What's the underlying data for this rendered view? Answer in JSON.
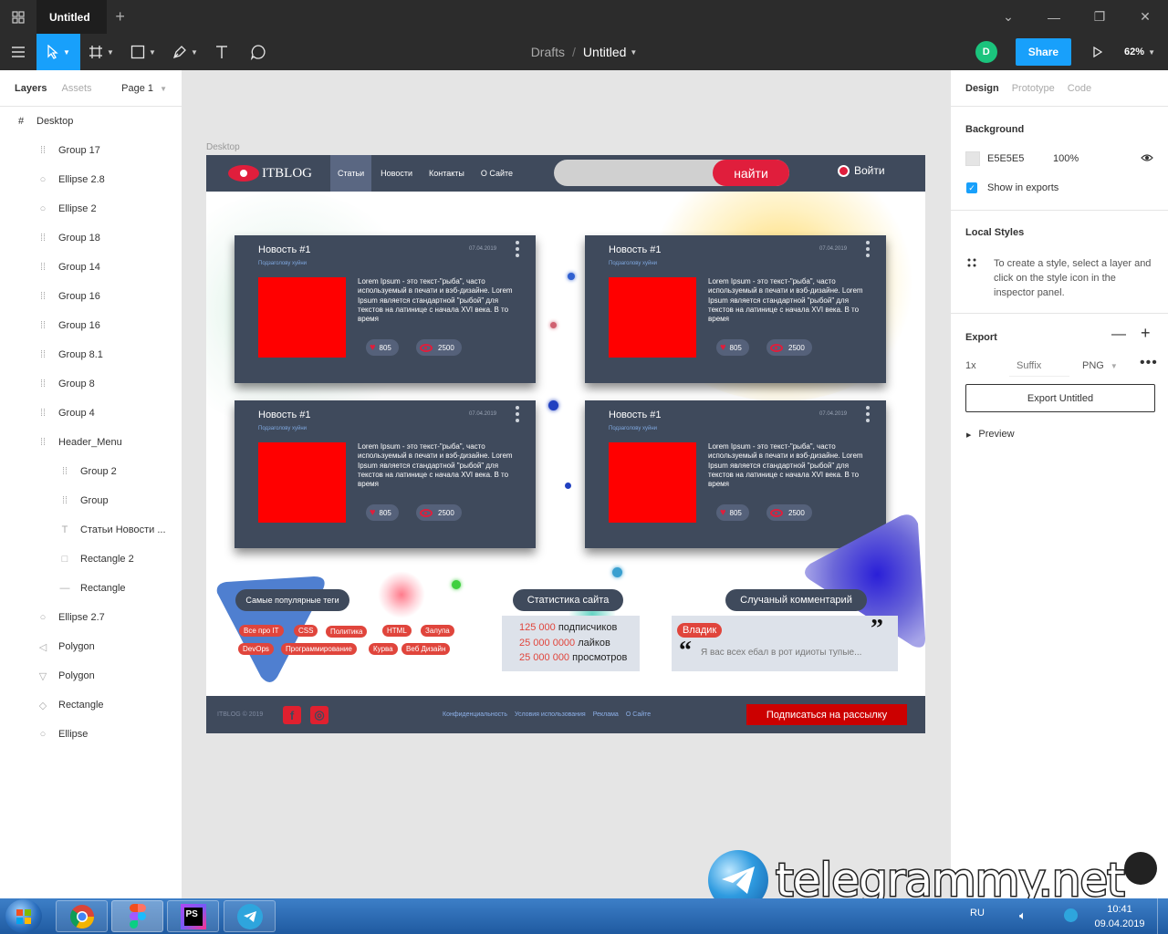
{
  "titlebar": {
    "tab_title": "Untitled",
    "plus": "+"
  },
  "toolbar": {
    "breadcrumb_drafts": "Drafts",
    "breadcrumb_sep": "/",
    "file_name": "Untitled",
    "avatar_initial": "D",
    "share_label": "Share",
    "zoom": "62%",
    "accent": "#18a0fb"
  },
  "left_panel": {
    "tab_layers": "Layers",
    "tab_assets": "Assets",
    "page": "Page 1",
    "layers": [
      {
        "name": "Desktop",
        "icon": "frame-icon",
        "indent": 0
      },
      {
        "name": "Group 17",
        "icon": "group-icon",
        "indent": 1
      },
      {
        "name": "Ellipse 2.8",
        "icon": "ellipse-icon",
        "indent": 1
      },
      {
        "name": "Ellipse 2",
        "icon": "ellipse-icon",
        "indent": 1
      },
      {
        "name": "Group 18",
        "icon": "group-icon",
        "indent": 1
      },
      {
        "name": "Group 14",
        "icon": "group-icon",
        "indent": 1
      },
      {
        "name": "Group 16",
        "icon": "group-icon",
        "indent": 1
      },
      {
        "name": "Group 16",
        "icon": "group-icon",
        "indent": 1
      },
      {
        "name": "Group 8.1",
        "icon": "group-icon",
        "indent": 1
      },
      {
        "name": "Group 8",
        "icon": "group-icon",
        "indent": 1
      },
      {
        "name": "Group 4",
        "icon": "group-icon",
        "indent": 1
      },
      {
        "name": "Header_Menu",
        "icon": "group-icon",
        "indent": 1
      },
      {
        "name": "Group 2",
        "icon": "group-icon",
        "indent": 2
      },
      {
        "name": "Group",
        "icon": "group-icon",
        "indent": 2
      },
      {
        "name": "Статьи Новости ...",
        "icon": "text-icon",
        "indent": 2
      },
      {
        "name": "Rectangle 2",
        "icon": "rectangle-icon",
        "indent": 2
      },
      {
        "name": "Rectangle",
        "icon": "line-icon",
        "indent": 2
      },
      {
        "name": "Ellipse 2.7",
        "icon": "ellipse-icon",
        "indent": 1
      },
      {
        "name": "Polygon",
        "icon": "polygon-icon",
        "indent": 1
      },
      {
        "name": "Polygon",
        "icon": "polygon-down-icon",
        "indent": 1
      },
      {
        "name": "Rectangle",
        "icon": "rectangle-rotated-icon",
        "indent": 1
      },
      {
        "name": "Ellipse",
        "icon": "ellipse-icon",
        "indent": 1
      }
    ]
  },
  "canvas": {
    "frame_label": "Desktop",
    "site": {
      "logo_text": "ITBLOG",
      "nav": [
        "Статьи",
        "Новости",
        "Контакты",
        "О Сайте"
      ],
      "search_button": "найти",
      "login": "Войти",
      "card": {
        "title": "Новость #1",
        "subtitle": "Подзаголову хуйни",
        "date": "07.04.2019",
        "text": "Lorem Ipsum - это текст-\"рыба\", часто используемый в печати и вэб-дизайне. Lorem Ipsum является стандартной \"рыбой\" для текстов на латинице с начала XVI века. В то время",
        "likes": "805",
        "views": "2500"
      },
      "tags_title": "Самые популярные теги",
      "tags": [
        "Все про IT",
        "CSS",
        "Политика",
        "HTML",
        "Залупа",
        "DevOps",
        "Программирование",
        "Курва",
        "Веб Дизайн"
      ],
      "stats_title": "Статистика сайта",
      "stats": [
        {
          "num": "125 000",
          "label": "подписчиков"
        },
        {
          "num": "25 000 0000",
          "label": "лайков"
        },
        {
          "num": "25 000 000",
          "label": "просмотров"
        }
      ],
      "comment_title": "Случаный комментарий",
      "comment_author": "Владик",
      "comment_text": "Я вас всех ебал в рот идиоты тупые...",
      "footer_copy": "ITBLOG © 2019",
      "footer_links": [
        "Конфиденциальность",
        "Условия использования",
        "Реклама",
        "О Сайте"
      ],
      "subscribe": "Подписаться на рассылку",
      "colors": {
        "header": "#3f4a5c",
        "accent": "#e01e3c",
        "tag": "#e0453c"
      }
    }
  },
  "right_panel": {
    "tab_design": "Design",
    "tab_prototype": "Prototype",
    "tab_code": "Code",
    "background_title": "Background",
    "bg_hex": "E5E5E5",
    "bg_opacity": "100%",
    "show_exports": "Show in exports",
    "local_styles_title": "Local Styles",
    "local_styles_hint": "To create a style, select a layer and click on the style icon in the inspector panel.",
    "export_title": "Export",
    "export_scale": "1x",
    "export_suffix_placeholder": "Suffix",
    "export_format": "PNG",
    "export_button": "Export Untitled",
    "preview": "Preview"
  },
  "taskbar": {
    "lang": "RU",
    "time": "10:41",
    "date": "09.04.2019",
    "apps": [
      "chrome-icon",
      "figma-icon",
      "photoshop-icon",
      "telegram-icon"
    ]
  },
  "watermark": {
    "text": "telegrammy.net"
  }
}
